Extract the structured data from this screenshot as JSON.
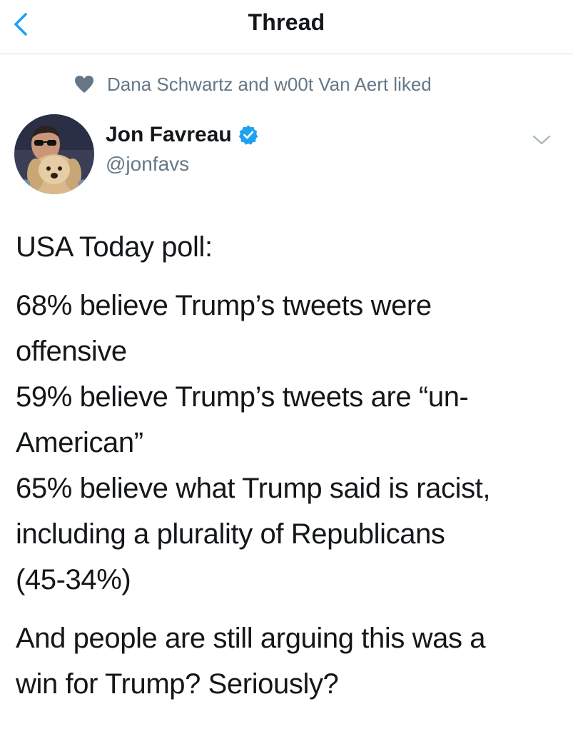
{
  "nav": {
    "title": "Thread",
    "back_icon": "chevron-left-icon"
  },
  "social_context": {
    "icon": "heart-icon",
    "text": "Dana Schwartz and w00t Van Aert liked"
  },
  "tweet": {
    "author": {
      "name": "Jon Favreau",
      "handle": "@jonfavs",
      "verified": true
    },
    "menu_icon": "chevron-down-icon",
    "paragraphs": [
      {
        "lines": [
          "USA Today poll:"
        ]
      },
      {
        "lines": [
          "68% believe Trump’s tweets were",
          "offensive",
          "59% believe Trump’s tweets are “un-",
          "American”",
          "65% believe what Trump said is racist,",
          "including a plurality of Republicans",
          "(45-34%)"
        ]
      },
      {
        "lines": [
          "And people are still arguing this was a",
          "win for Trump? Seriously?"
        ]
      }
    ]
  },
  "colors": {
    "accent": "#1da1f2",
    "text_primary": "#14171a",
    "text_secondary": "#657786",
    "divider": "#d9dde1"
  }
}
